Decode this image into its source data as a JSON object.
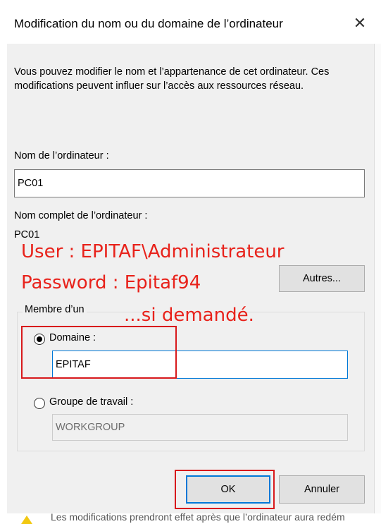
{
  "window": {
    "title": "Modification du nom ou du domaine de l’ordinateur",
    "close_glyph": "✕"
  },
  "description": "Vous pouvez modifier le nom et l’appartenance de cet ordinateur. Ces modifications peuvent influer sur l’accès aux ressources réseau.",
  "computer_name": {
    "label": "Nom de l’ordinateur :",
    "value": "PC01"
  },
  "full_name": {
    "label": "Nom complet de l’ordinateur :",
    "value": "PC01"
  },
  "more_button": "Autres...",
  "member_of": {
    "legend": "Membre d’un",
    "domain": {
      "label": "Domaine :",
      "value": "EPITAF",
      "selected": true
    },
    "workgroup": {
      "label": "Groupe de travail :",
      "value": "WORKGROUP",
      "selected": false
    }
  },
  "buttons": {
    "ok": "OK",
    "cancel": "Annuler"
  },
  "annotation": {
    "line1": "User : EPITAF\\Administrateur",
    "line2": "Password : Epitaf94",
    "line3": "...si demandé.",
    "color": "#e8221b"
  },
  "background_text": "Les modifications prendront effet après que l’ordinateur aura redém",
  "colors": {
    "accent": "#0078d7",
    "highlight_box": "#d8191c"
  }
}
